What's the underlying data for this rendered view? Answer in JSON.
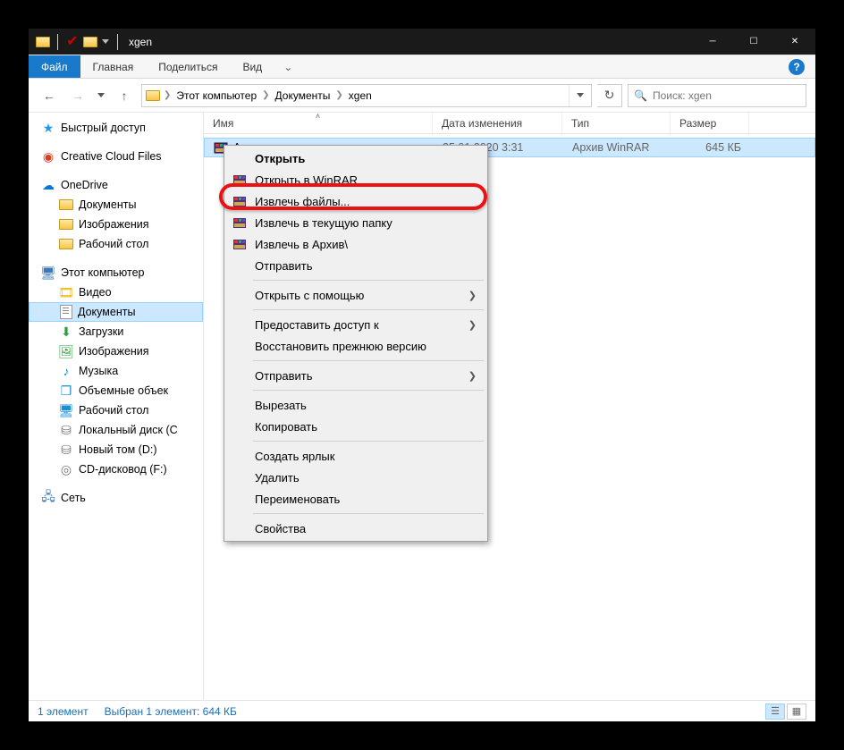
{
  "title": "xgen",
  "tabs": {
    "file": "Файл",
    "home": "Главная",
    "share": "Поделиться",
    "view": "Вид"
  },
  "breadcrumb": {
    "pc": "Этот компьютер",
    "docs": "Документы",
    "folder": "xgen"
  },
  "search": {
    "placeholder": "Поиск: xgen"
  },
  "columns": {
    "name": "Имя",
    "date": "Дата изменения",
    "type": "Тип",
    "size": "Размер"
  },
  "sidebar": {
    "quick": "Быстрый доступ",
    "ccf": "Creative Cloud Files",
    "onedrive": "OneDrive",
    "od_docs": "Документы",
    "od_images": "Изображения",
    "od_desktop": "Рабочий стол",
    "pc": "Этот компьютер",
    "pc_video": "Видео",
    "pc_docs": "Документы",
    "pc_downloads": "Загрузки",
    "pc_images": "Изображения",
    "pc_music": "Музыка",
    "pc_3d": "Объемные объек",
    "pc_desktop": "Рабочий стол",
    "pc_localdisk": "Локальный диск (C",
    "pc_newvol": "Новый том (D:)",
    "pc_cd": "CD-дисковод (F:)",
    "network": "Сеть"
  },
  "file": {
    "name": "Архив",
    "date": "25.01.2020 3:31",
    "type": "Архив WinRAR",
    "size": "645 КБ"
  },
  "context": {
    "open": "Открыть",
    "open_winrar": "Открыть в WinRAR",
    "extract_files": "Извлечь файлы...",
    "extract_here": "Извлечь в текущую папку",
    "extract_to": "Извлечь в Архив\\",
    "send": "Отправить",
    "open_with": "Открыть с помощью",
    "give_access": "Предоставить доступ к",
    "restore": "Восстановить прежнюю версию",
    "send_to": "Отправить",
    "cut": "Вырезать",
    "copy": "Копировать",
    "shortcut": "Создать ярлык",
    "delete": "Удалить",
    "rename": "Переименовать",
    "properties": "Свойства"
  },
  "status": {
    "count": "1 элемент",
    "selected": "Выбран 1 элемент: 644 КБ"
  }
}
